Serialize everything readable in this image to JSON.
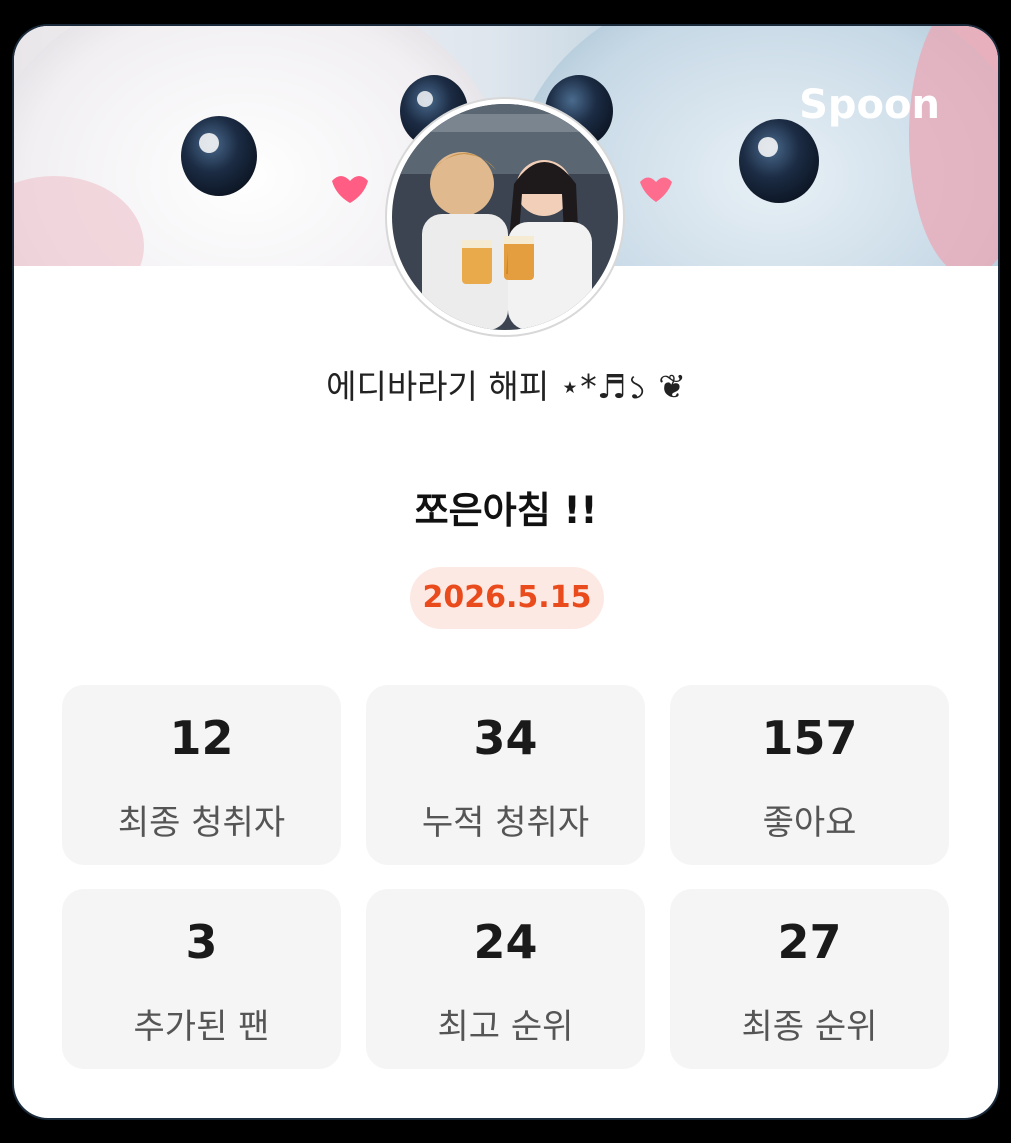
{
  "header": {
    "brand": "Spoon"
  },
  "profile": {
    "nickname": "에디바라기 해피 ⋆*♬১ ❦",
    "live_title": "쪼은아침 !!",
    "date": "2026.5.15"
  },
  "stats": [
    {
      "value": "12",
      "label": "최종 청취자"
    },
    {
      "value": "34",
      "label": "누적 청취자"
    },
    {
      "value": "157",
      "label": "좋아요"
    },
    {
      "value": "3",
      "label": "추가된 팬"
    },
    {
      "value": "24",
      "label": "최고 순위"
    },
    {
      "value": "27",
      "label": "최종 순위"
    }
  ],
  "colors": {
    "accent": "#ea4b1c",
    "badge_bg": "#fde9e3",
    "card_bg": "#ffffff",
    "stat_bg": "#f5f5f5"
  }
}
